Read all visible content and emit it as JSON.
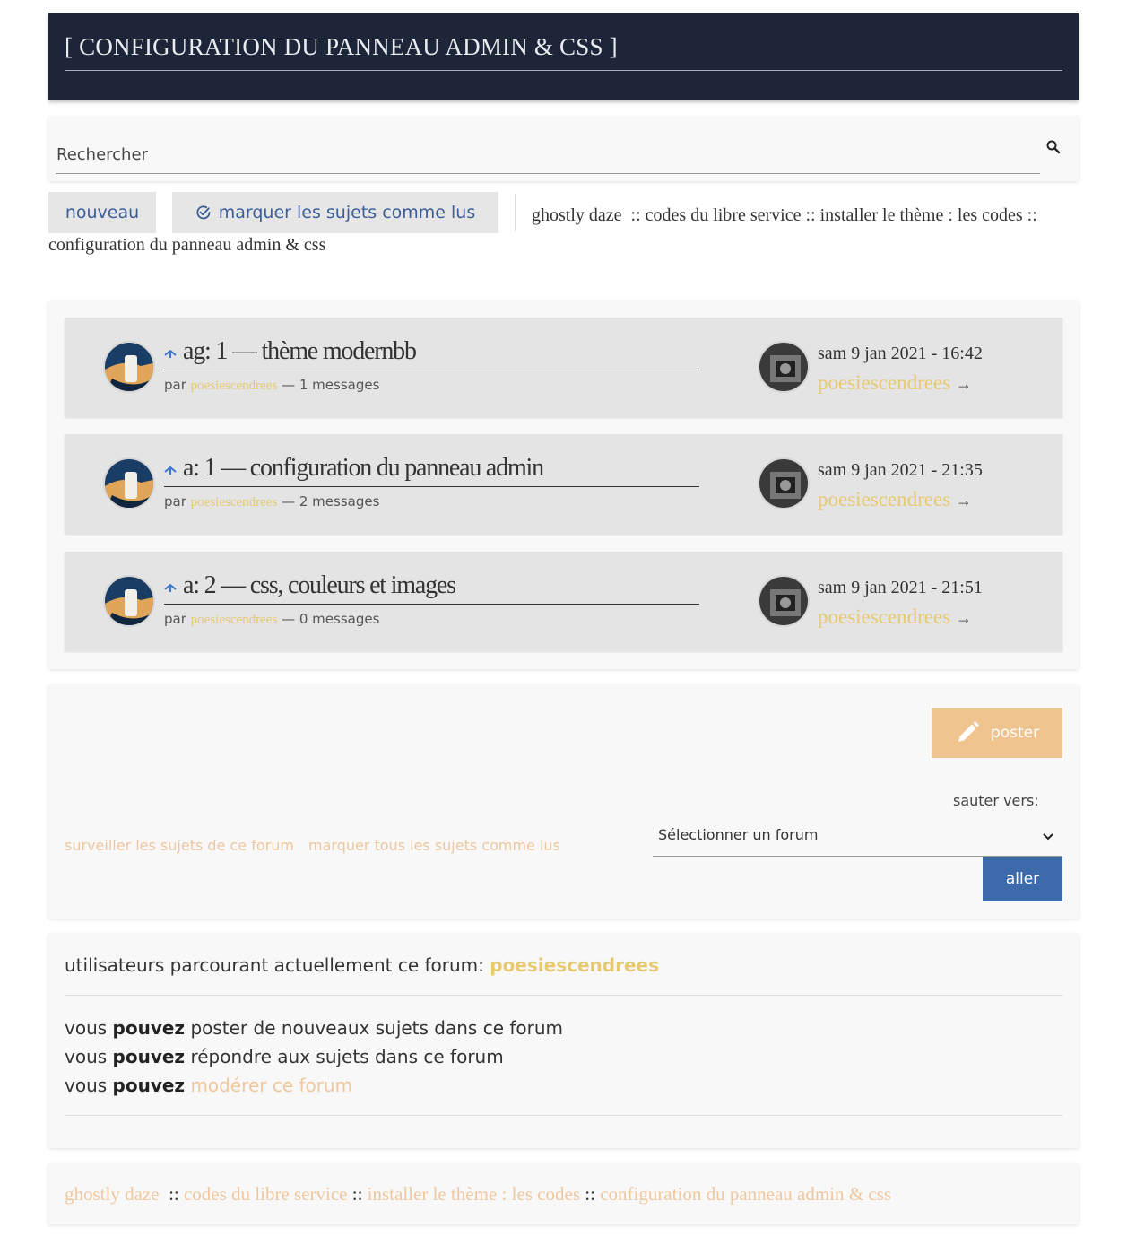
{
  "header": {
    "title": "[ CONFIGURATION DU PANNEAU ADMIN & CSS ]"
  },
  "search": {
    "placeholder": "Rechercher",
    "icon": "search-icon"
  },
  "toolbar": {
    "new_label": "nouveau",
    "mark_read_label": "marquer les sujets comme lus",
    "mark_read_icon": "check-circle-icon"
  },
  "breadcrumb": {
    "forum": "ghostly daze",
    "sep": "::",
    "cat1": "codes du libre service",
    "cat2": "installer le thème : les codes",
    "current": "configuration du panneau admin & css"
  },
  "topics": [
    {
      "title": "ag: 1 — thème modernbb",
      "by": "par",
      "author": "poesiescendrees",
      "count": "— 1 messages",
      "last_date": "sam 9 jan 2021 - 16:42",
      "last_author": "poesiescendrees",
      "arrow": "→"
    },
    {
      "title": "a: 1 — configuration du panneau admin",
      "by": "par",
      "author": "poesiescendrees",
      "count": "— 2 messages",
      "last_date": "sam 9 jan 2021 - 21:35",
      "last_author": "poesiescendrees",
      "arrow": "→"
    },
    {
      "title": "a: 2 — css, couleurs et images",
      "by": "par",
      "author": "poesiescendrees",
      "count": "— 0 messages",
      "last_date": "sam 9 jan 2021 - 21:51",
      "last_author": "poesiescendrees",
      "arrow": "→"
    }
  ],
  "actions": {
    "post_label": "poster",
    "post_icon": "pencil-icon",
    "jump_label": "sauter vers:",
    "select_value": "Sélectionner un forum",
    "go_label": "aller",
    "watch_link": "surveiller les sujets de ce forum",
    "mark_all_link": "marquer tous les sujets comme lus"
  },
  "info": {
    "users_label": "utilisateurs parcourant actuellement ce forum:",
    "users_name": "poesiescendrees",
    "perm_prefix": "vous",
    "perm_can": "pouvez",
    "perm1": "poster de nouveaux sujets dans ce forum",
    "perm2": "répondre aux sujets dans ce forum",
    "perm3": "modérer ce forum"
  },
  "colors": {
    "header_bg": "#1c2638",
    "accent_gold": "#e6c970",
    "link_peach": "#efc79e",
    "button_blue": "#3d6aab",
    "post_button": "#f0c48f"
  }
}
